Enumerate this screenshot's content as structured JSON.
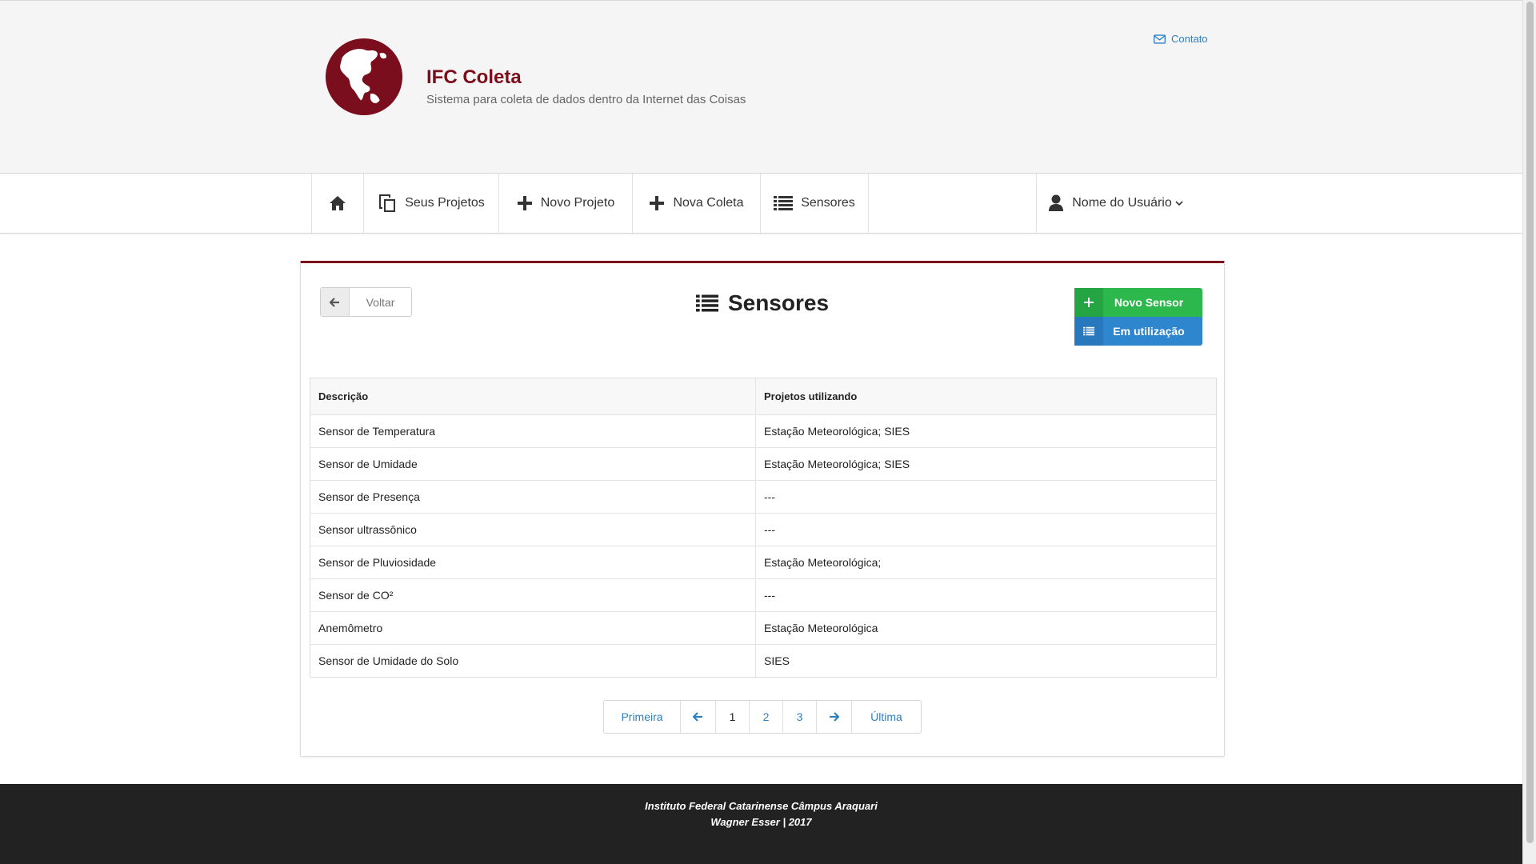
{
  "header": {
    "title": "IFC Coleta",
    "subtitle": "Sistema para coleta de dados dentro da Internet das Coisas",
    "contact_label": "Contato",
    "brand_color": "#7a0e1c"
  },
  "nav": {
    "home_icon": "home-icon",
    "items": [
      {
        "label": "Seus Projetos",
        "icon": "copy-icon"
      },
      {
        "label": "Novo Projeto",
        "icon": "plus-icon"
      },
      {
        "label": "Nova Coleta",
        "icon": "plus-icon"
      },
      {
        "label": "Sensores",
        "icon": "list-icon"
      }
    ],
    "user_label": "Nome do Usuário"
  },
  "page": {
    "back_label": "Voltar",
    "title": "Sensores",
    "new_sensor_label": "Novo Sensor",
    "in_use_label": "Em utilização",
    "green": "#2db84d",
    "blue": "#2e86cf"
  },
  "table": {
    "columns": [
      "Descrição",
      "Projetos utilizando"
    ],
    "rows": [
      [
        "Sensor de Temperatura",
        "Estação Meteorológica; SIES"
      ],
      [
        "Sensor de Umidade",
        "Estação Meteorológica; SIES"
      ],
      [
        "Sensor de Presença",
        "---"
      ],
      [
        "Sensor ultrassônico",
        "---"
      ],
      [
        "Sensor de Pluviosidade",
        "Estação Meteorológica;"
      ],
      [
        "Sensor de CO²",
        "---"
      ],
      [
        "Anemômetro",
        "Estação Meteorológica"
      ],
      [
        "Sensor de Umidade do Solo",
        "SIES"
      ]
    ]
  },
  "pagination": {
    "first": "Primeira",
    "pages": [
      "1",
      "2",
      "3"
    ],
    "current": "1",
    "last": "Última"
  },
  "footer": {
    "line1": "Instituto Federal Catarinense Câmpus Araquari",
    "line2": "Wagner Esser | 2017"
  }
}
